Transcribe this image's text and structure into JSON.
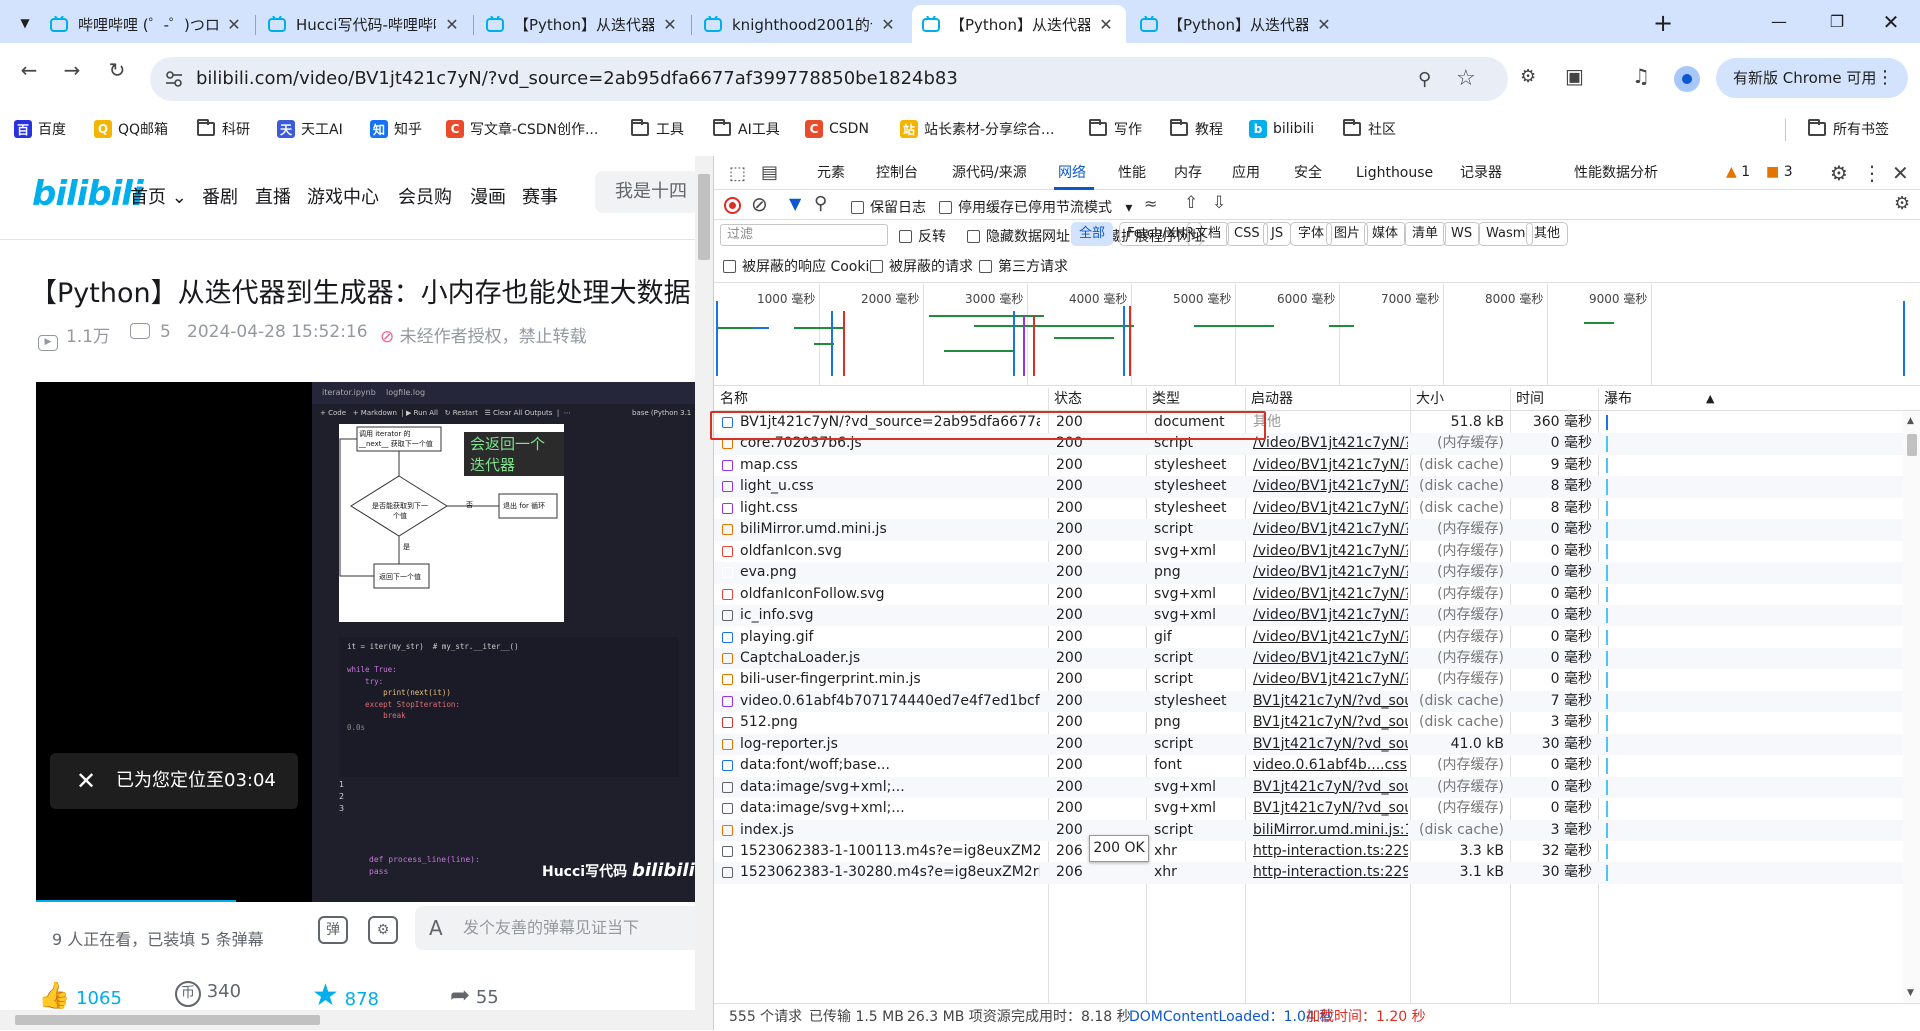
{
  "tabs": [
    {
      "title": "哔哩哔哩 (゜-゜)つロ 干杯"
    },
    {
      "title": "Hucci写代码-哔哩哔哩_bili"
    },
    {
      "title": "【Python】从迭代器到生成"
    },
    {
      "title": "knighthood2001的个人空间"
    },
    {
      "title": "【Python】从迭代器到生成"
    },
    {
      "title": "【Python】从迭代器到生成"
    }
  ],
  "omnibox": {
    "url": "bilibili.com/video/BV1jt421c7yN/?vd_source=2ab95dfa6677af399778850be1824b83"
  },
  "update_button": "有新版 Chrome 可用",
  "bookmarks": [
    {
      "label": "百度"
    },
    {
      "label": "QQ邮箱"
    },
    {
      "label": "科研"
    },
    {
      "label": "天工AI"
    },
    {
      "label": "知乎"
    },
    {
      "label": "写文章-CSDN创作..."
    },
    {
      "label": "工具"
    },
    {
      "label": "AI工具"
    },
    {
      "label": "CSDN"
    },
    {
      "label": "站长素材-分享综合..."
    },
    {
      "label": "写作"
    },
    {
      "label": "教程"
    },
    {
      "label": "bilibili"
    },
    {
      "label": "社区"
    }
  ],
  "all_bookmarks": "所有书签",
  "site": {
    "logo": "bilibili",
    "nav": [
      "首页",
      "番剧",
      "直播",
      "游戏中心",
      "会员购",
      "漫画",
      "赛事"
    ],
    "search_placeholder": "我是十四",
    "video_title": "【Python】从迭代器到生成器：小内存也能处理大数据",
    "views": "1.1万",
    "danmaku_count": "5",
    "date": "2024-04-28 15:52:16",
    "copyright": "未经作者授权，禁止转载",
    "resume_toast": "已为您定位至03:04",
    "overlay_caption": "会返回一个迭代器",
    "watermark": "Hucci写代码",
    "watching": "9 人正在看，已装填 5 条弹幕",
    "danmaku_placeholder": "发个友善的弹幕见证当下",
    "likes": "1065",
    "coins": "340",
    "favs": "878",
    "shares": "55",
    "jupyter": {
      "tab1": "iterator.ipynb",
      "tab2": "logfile.log",
      "toolbar": [
        "Code",
        "Markdown",
        "Run All",
        "Restart",
        "Clear All Outputs"
      ],
      "kernel": "base (Python 3.1",
      "flow": {
        "top": "调用 iterator 的 __next__ 获取下一个值",
        "diamond": "是否能获取到下一个值",
        "no": "否",
        "yes": "是",
        "exit": "退出 for 循环",
        "ret": "返回下一个值"
      },
      "code": [
        "it = iter(my_str)  # my_str.__iter__()",
        "",
        "while True:",
        "    try:",
        "        print(next(it))",
        "    except StopIteration:",
        "        break"
      ],
      "outputs": [
        "1",
        "2",
        "3"
      ],
      "code2": [
        "def process_line(line):",
        "    pass"
      ],
      "time": "0.0s"
    }
  },
  "devtools": {
    "tabs": [
      "元素",
      "控制台",
      "源代码/来源",
      "网络",
      "性能",
      "内存",
      "应用",
      "安全",
      "Lighthouse",
      "记录器",
      "性能数据分析"
    ],
    "warnings": "1",
    "issues": "3",
    "preserve_log": "保留日志",
    "disable_cache": "停用缓存",
    "throttling": "已停用节流模式",
    "filter_placeholder": "过滤",
    "invert": "反转",
    "hide_data_urls": "隐藏数据网址",
    "hide_ext_urls": "隐藏扩展程序网址",
    "type_chips": [
      "全部",
      "Fetch/XHR",
      "文档",
      "CSS",
      "JS",
      "字体",
      "图片",
      "媒体",
      "清单",
      "WS",
      "Wasm",
      "其他"
    ],
    "blocked_cookies": "被屏蔽的响应 Cookie",
    "blocked_requests": "被屏蔽的请求",
    "third_party": "第三方请求",
    "timeline_ticks": [
      "1000 毫秒",
      "2000 毫秒",
      "3000 毫秒",
      "4000 毫秒",
      "5000 毫秒",
      "6000 毫秒",
      "7000 毫秒",
      "8000 毫秒",
      "9000 毫秒"
    ],
    "columns": [
      "名称",
      "状态",
      "类型",
      "启动器",
      "大小",
      "时间",
      "瀑布"
    ],
    "rows": [
      {
        "name": "BV1jt421c7yN/?vd_source=2ab95dfa6677af399778850...",
        "status": "200",
        "type": "document",
        "initiator": "其他",
        "size": "51.8 kB",
        "time": "360 毫秒",
        "color": "#1a73e8"
      },
      {
        "name": "core.702037b6.js",
        "status": "200",
        "type": "script",
        "initiator": "/video/BV1jt421c7yN/?vd ...",
        "size": "(内存缓存)",
        "time": "0 毫秒",
        "color": "#e37400"
      },
      {
        "name": "map.css",
        "status": "200",
        "type": "stylesheet",
        "initiator": "/video/BV1jt421c7yN/?vd ...",
        "size": "(disk cache)",
        "time": "9 毫秒",
        "color": "#9334e6"
      },
      {
        "name": "light_u.css",
        "status": "200",
        "type": "stylesheet",
        "initiator": "/video/BV1jt421c7yN/?vd ...",
        "size": "(disk cache)",
        "time": "8 毫秒",
        "color": "#9334e6"
      },
      {
        "name": "light.css",
        "status": "200",
        "type": "stylesheet",
        "initiator": "/video/BV1jt421c7yN/?vd ...",
        "size": "(disk cache)",
        "time": "8 毫秒",
        "color": "#9334e6"
      },
      {
        "name": "biliMirror.umd.mini.js",
        "status": "200",
        "type": "script",
        "initiator": "/video/BV1jt421c7yN/?vd ...",
        "size": "(内存缓存)",
        "time": "0 毫秒",
        "color": "#e37400"
      },
      {
        "name": "oldfanIcon.svg",
        "status": "200",
        "type": "svg+xml",
        "initiator": "/video/BV1jt421c7yN/?vd ...",
        "size": "(内存缓存)",
        "time": "0 毫秒",
        "color": "#ea4335"
      },
      {
        "name": "eva.png",
        "status": "200",
        "type": "png",
        "initiator": "/video/BV1jt421c7yN/?vd ...",
        "size": "(内存缓存)",
        "time": "0 毫秒",
        "color": "#ffffff"
      },
      {
        "name": "oldfanIconFollow.svg",
        "status": "200",
        "type": "svg+xml",
        "initiator": "/video/BV1jt421c7yN/?vd ...",
        "size": "(内存缓存)",
        "time": "0 毫秒",
        "color": "#ea4335"
      },
      {
        "name": "ic_info.svg",
        "status": "200",
        "type": "svg+xml",
        "initiator": "/video/BV1jt421c7yN/?vd ...",
        "size": "(内存缓存)",
        "time": "0 毫秒",
        "color": "#5f6368"
      },
      {
        "name": "playing.gif",
        "status": "200",
        "type": "gif",
        "initiator": "/video/BV1jt421c7yN/?vd ...",
        "size": "(内存缓存)",
        "time": "0 毫秒",
        "color": "#1a73e8"
      },
      {
        "name": "CaptchaLoader.js",
        "status": "200",
        "type": "script",
        "initiator": "/video/BV1jt421c7yN/?vd ...",
        "size": "(内存缓存)",
        "time": "0 毫秒",
        "color": "#e37400"
      },
      {
        "name": "bili-user-fingerprint.min.js",
        "status": "200",
        "type": "script",
        "initiator": "/video/BV1jt421c7yN/?vd ...",
        "size": "(内存缓存)",
        "time": "0 毫秒",
        "color": "#e37400"
      },
      {
        "name": "video.0.61abf4b707174440ed7e4f7ed1bcf673e1570c42...",
        "status": "200",
        "type": "stylesheet",
        "initiator": "BV1jt421c7yN/?vd_source...",
        "size": "(disk cache)",
        "time": "7 毫秒",
        "color": "#9334e6"
      },
      {
        "name": "512.png",
        "status": "200",
        "type": "png",
        "initiator": "BV1jt421c7yN/?vd_source...",
        "size": "(disk cache)",
        "time": "3 毫秒",
        "color": "#d93025"
      },
      {
        "name": "log-reporter.js",
        "status": "200",
        "type": "script",
        "initiator": "BV1jt421c7yN/?vd_source...",
        "size": "41.0 kB",
        "time": "30 毫秒",
        "color": "#e37400"
      },
      {
        "name": "data:font/woff;base...",
        "status": "200",
        "type": "font",
        "initiator": "video.0.61abf4b....css",
        "size": "(内存缓存)",
        "time": "0 毫秒",
        "color": "#1a73e8"
      },
      {
        "name": "data:image/svg+xml;...",
        "status": "200",
        "type": "svg+xml",
        "initiator": "BV1jt421c7yN/?vd_source...",
        "size": "(内存缓存)",
        "time": "0 毫秒",
        "color": "#5f6368"
      },
      {
        "name": "data:image/svg+xml;...",
        "status": "200",
        "type": "svg+xml",
        "initiator": "BV1jt421c7yN/?vd_source...",
        "size": "(内存缓存)",
        "time": "0 毫秒",
        "color": "#5f6368"
      },
      {
        "name": "index.js",
        "status": "200",
        "type": "script",
        "initiator": "biliMirror.umd.mini.js:1",
        "size": "(disk cache)",
        "time": "3 毫秒",
        "color": "#e37400"
      },
      {
        "name": "1523062383-1-100113.m4s?e=ig8euxZM2rNcNbdlhoN...",
        "status": "206",
        "type": "xhr",
        "initiator": "http-interaction.ts:229",
        "size": "3.3 kB",
        "time": "32 毫秒",
        "color": "#5f6368"
      },
      {
        "name": "1523062383-1-30280.m4s?e=ig8euxZM2rNcNbdlhoNv...",
        "status": "206",
        "type": "xhr",
        "initiator": "http-interaction.ts:229",
        "size": "3.1 kB",
        "time": "30 毫秒",
        "color": "#5f6368"
      }
    ],
    "tooltip": "200 OK",
    "status": {
      "requests": "555 个请求",
      "transferred": "已传输 1.5 MB",
      "resources": "26.3 MB 项资源",
      "finish": "完成用时：8.18 秒",
      "dcl": "DOMContentLoaded：1.04 秒",
      "load": "加载时间：1.20 秒"
    }
  }
}
